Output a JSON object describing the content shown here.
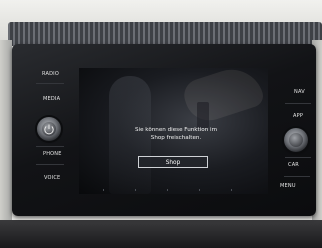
{
  "left_buttons": [
    {
      "label": "RADIO"
    },
    {
      "label": "MEDIA"
    },
    {
      "label": "PHONE"
    },
    {
      "label": "VOICE"
    }
  ],
  "right_buttons": [
    {
      "label": "NAV"
    },
    {
      "label": "APP"
    },
    {
      "label": "CAR"
    },
    {
      "label": "MENU"
    }
  ],
  "screen": {
    "message_line1": "Sie können diese Funktion im",
    "message_line2": "Shop freischalten.",
    "shop_button": "Shop"
  },
  "knobs": {
    "left": "power-volume-knob",
    "right": "tune-knob"
  }
}
